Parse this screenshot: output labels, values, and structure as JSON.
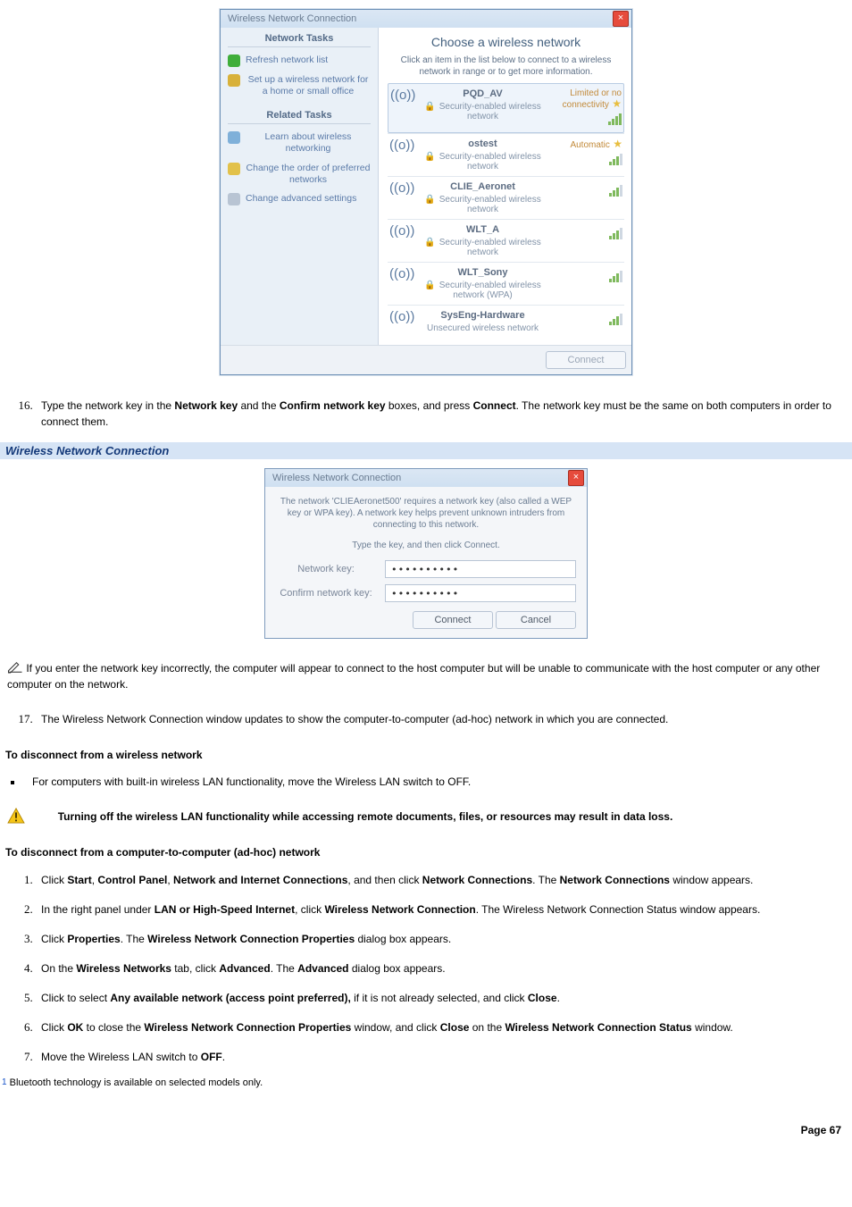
{
  "fig1": {
    "title": "Wireless Network Connection",
    "side": {
      "tasks_head": "Network Tasks",
      "refresh": "Refresh network list",
      "setup": "Set up a wireless network for a home or small office",
      "related_head": "Related Tasks",
      "learn": "Learn about wireless networking",
      "order": "Change the order of preferred networks",
      "adv": "Change advanced settings"
    },
    "main": {
      "heading": "Choose a wireless network",
      "help": "Click an item in the list below to connect to a wireless network in range or to get more information.",
      "items": [
        {
          "ssid": "PQD_AV",
          "sec": "Security-enabled wireless network",
          "status": "Limited or no connectivity",
          "star": true,
          "bars": 4,
          "selected": true
        },
        {
          "ssid": "ostest",
          "sec": "Security-enabled wireless network",
          "status": "Automatic",
          "star": true,
          "bars": 3,
          "selected": false
        },
        {
          "ssid": "CLIE_Aeronet",
          "sec": "Security-enabled wireless network",
          "status": "",
          "star": false,
          "bars": 3,
          "selected": false
        },
        {
          "ssid": "WLT_A",
          "sec": "Security-enabled wireless network",
          "status": "",
          "star": false,
          "bars": 3,
          "selected": false
        },
        {
          "ssid": "WLT_Sony",
          "sec": "Security-enabled wireless network (WPA)",
          "status": "",
          "star": false,
          "bars": 3,
          "selected": false
        },
        {
          "ssid": "SysEng-Hardware",
          "sec": "Unsecured wireless network",
          "status": "",
          "star": false,
          "bars": 3,
          "selected": false
        }
      ],
      "connect": "Connect"
    }
  },
  "step16": {
    "pre": "Type the network key in the ",
    "b1": "Network key",
    "mid1": " and the ",
    "b2": "Confirm network key",
    "mid2": " boxes, and press ",
    "b3": "Connect",
    "post": ". The network key must be the same on both computers in order to connect them."
  },
  "section_bar": "Wireless Network Connection",
  "fig2": {
    "title": "Wireless Network Connection",
    "help": "The network 'CLIEAeronet500' requires a network key (also called a WEP key or WPA key). A network key helps prevent unknown intruders from connecting to this network.",
    "instruction": "Type the key, and then click Connect.",
    "label_key": "Network key:",
    "label_confirm": "Confirm network key:",
    "mask": "••••••••••",
    "btn_connect": "Connect",
    "btn_cancel": "Cancel"
  },
  "note1": " If you enter the network key incorrectly, the computer will appear to connect to the host computer but will be unable to communicate with the host computer or any other computer on the network.",
  "step17": "The Wireless Network Connection window updates to show the computer-to-computer (ad-hoc) network in which you are connected.",
  "head_disconnect": "To disconnect from a wireless network",
  "bullet_disc": "For computers with built-in wireless LAN functionality, move the Wireless LAN switch to OFF.",
  "warn": "Turning off the wireless LAN functionality while accessing remote documents, files, or resources may result in data loss.",
  "head_adhoc": "To disconnect from a computer-to-computer (ad-hoc) network",
  "adhoc_steps": {
    "s1": {
      "a": "Click ",
      "b1": "Start",
      "c": ", ",
      "b2": "Control Panel",
      "d": ", ",
      "b3": "Network and Internet Connections",
      "e": ", and then click ",
      "b4": "Network Connections",
      "f": ". The ",
      "b5": "Network Connections",
      "g": " window appears."
    },
    "s2": {
      "a": "In the right panel under ",
      "b1": "LAN or High-Speed Internet",
      "c": ", click ",
      "b2": "Wireless Network Connection",
      "d": ". The Wireless Network Connection Status window appears."
    },
    "s3": {
      "a": "Click ",
      "b1": "Properties",
      "c": ". The ",
      "b2": "Wireless Network Connection Properties",
      "d": " dialog box appears."
    },
    "s4": {
      "a": "On the ",
      "b1": "Wireless Networks",
      "c": " tab, click ",
      "b2": "Advanced",
      "d": ". The ",
      "b3": "Advanced",
      "e": " dialog box appears."
    },
    "s5": {
      "a": "Click to select ",
      "b1": "Any available network (access point preferred),",
      "c": " if it is not already selected, and click ",
      "b2": "Close",
      "d": "."
    },
    "s6": {
      "a": "Click ",
      "b1": "OK",
      "c": " to close the ",
      "b2": "Wireless Network Connection Properties",
      "d": " window, and click ",
      "b3": "Close",
      "e": " on the ",
      "b4": "Wireless Network Connection Status",
      "f": " window."
    },
    "s7": {
      "a": "Move the Wireless LAN switch to ",
      "b1": "OFF",
      "c": "."
    }
  },
  "footnote": {
    "mark": "1",
    "text": " Bluetooth technology is available on selected models only."
  },
  "page": "Page 67"
}
